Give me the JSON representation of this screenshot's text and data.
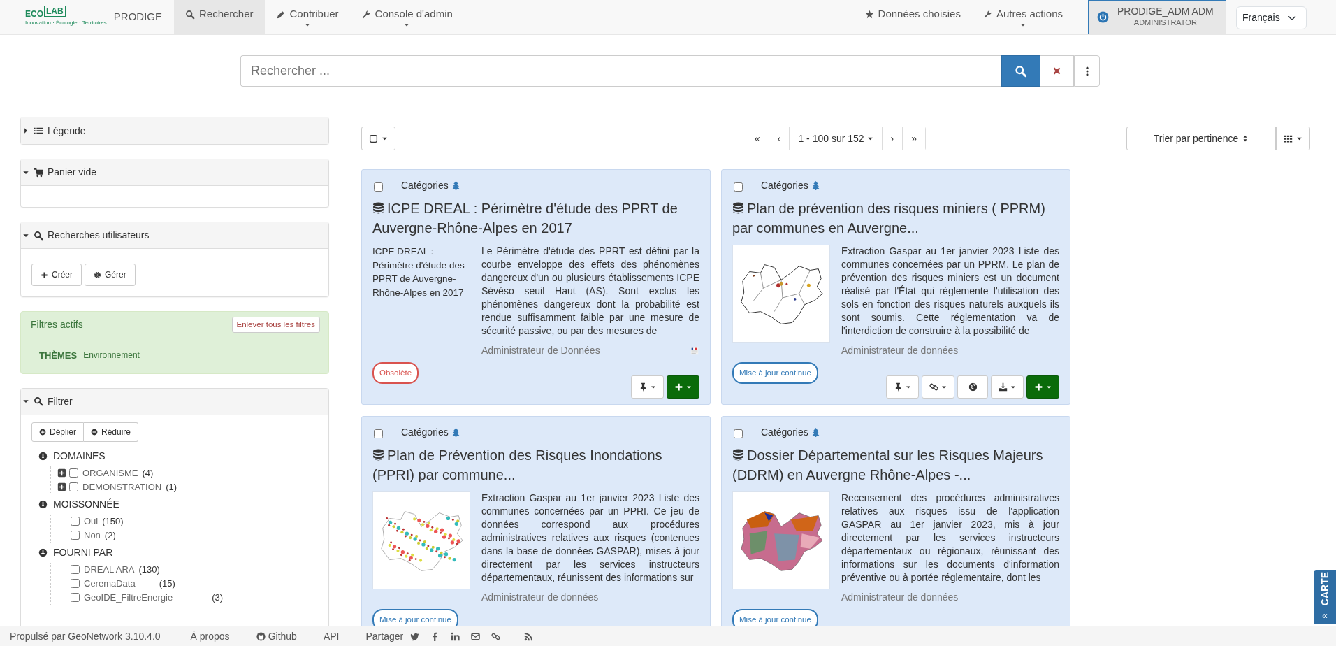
{
  "navbar": {
    "logo_left": "ECO",
    "logo_right": "LAB",
    "logo_tagline": "Innovation · Écologie · Territoires",
    "brand": "PRODIGE",
    "items": [
      {
        "label": "Rechercher",
        "selected": true,
        "dropdown": false
      },
      {
        "label": "Contribuer",
        "selected": false,
        "dropdown": true
      },
      {
        "label": "Console d'admin",
        "selected": false,
        "dropdown": true
      }
    ],
    "right_items": [
      {
        "label": "Données choisies",
        "dropdown": false
      },
      {
        "label": "Autres actions",
        "dropdown": true
      }
    ],
    "user": {
      "name": "PRODIGE_ADM ADM",
      "role": "ADMINISTRATOR"
    },
    "language": "Français"
  },
  "search": {
    "placeholder": "Rechercher ..."
  },
  "sidebar": {
    "legend": {
      "title": "Légende",
      "expanded": false
    },
    "cart": {
      "title": "Panier vide",
      "expanded": true
    },
    "user_searches": {
      "title": "Recherches utilisateurs",
      "expanded": true,
      "buttons": [
        "Créer",
        "Gérer"
      ]
    },
    "active_filters": {
      "title": "Filtres actifs",
      "clear_button": "Enlever tous les filtres",
      "filters": [
        {
          "field": "THÈMES",
          "value": "Environnement"
        }
      ]
    },
    "filter": {
      "title": "Filtrer",
      "expanded": true,
      "buttons": [
        "Déplier",
        "Réduire"
      ],
      "groups": [
        {
          "label": "DOMAINES",
          "expanded": true,
          "items": [
            {
              "label": "ORGANISME",
              "count": "(4)",
              "checked": false,
              "expandable": true
            },
            {
              "label": "DEMONSTRATION",
              "count": "(1)",
              "checked": false,
              "expandable": true
            }
          ]
        },
        {
          "label": "MOISSONNÉE",
          "expanded": true,
          "items": [
            {
              "label": "Oui",
              "count": "(150)",
              "checked": false,
              "expandable": false
            },
            {
              "label": "Non",
              "count": "(2)",
              "checked": false,
              "expandable": false
            }
          ]
        },
        {
          "label": "FOURNI PAR",
          "expanded": true,
          "items": [
            {
              "label": "DREAL ARA",
              "count": "(130)",
              "checked": false,
              "expandable": false
            },
            {
              "label": "CeremaData",
              "count": "(15)",
              "checked": false,
              "expandable": false
            },
            {
              "label": "GeoIDE_FiltreEnergie",
              "count": "(3)",
              "checked": false,
              "expandable": false
            }
          ]
        }
      ]
    }
  },
  "toolbar": {
    "select_all_checked": false,
    "pagination": [
      "«",
      "‹",
      "1 - 100 sur 152",
      "›",
      "»"
    ],
    "sort": "Trier par pertinence"
  },
  "cards": [
    {
      "checked": false,
      "category": "Catégories",
      "title": "ICPE DREAL : Périmètre d'étude des PPRT de Auvergne-Rhône-Alpes en 2017",
      "thumbnail": {
        "kind": "text",
        "text": "ICPE DREAL : Périmètre d'étude des PPRT de Auvergne-Rhône-Alpes en 2017"
      },
      "abstract": "Le Périmètre d'étude des PPRT est défini par la courbe enveloppe des effets des phénomènes dangereux d'un ou plusieurs établissements ICPE Sévéso seuil Haut (AS). Sont exclus les phénomènes dangereux dont la probabilité est rendue suffisamment faible par une mesure de sécurité passive, ou par des mesures de",
      "author": "Administrateur de Données",
      "flag": true,
      "status": {
        "kind": "obsolete",
        "label": "Obsolète"
      },
      "actions": [
        {
          "kind": "pin",
          "dropdown": true
        },
        {
          "kind": "add",
          "dropdown": true
        }
      ]
    },
    {
      "checked": false,
      "category": "Catégories",
      "title": "Plan de prévention des risques miniers ( PPRM) par communes en Auvergne...",
      "thumbnail": {
        "kind": "outline_map"
      },
      "abstract": "Extraction Gaspar au 1er janvier 2023 Liste des communes concernées par un PPRM. Le plan de prévention des risques miniers est un document réalisé par l'État qui réglemente l'utilisation des sols en fonction des risques naturels auxquels ils sont soumis. Cette réglementation va de l'interdiction de construire à la possibilité de",
      "author": "Administrateur de données",
      "flag": false,
      "status": {
        "kind": "continuous",
        "label": "Mise à jour continue"
      },
      "actions": [
        {
          "kind": "pin",
          "dropdown": true
        },
        {
          "kind": "links",
          "dropdown": true
        },
        {
          "kind": "globe",
          "dropdown": false
        },
        {
          "kind": "download",
          "dropdown": true
        },
        {
          "kind": "add",
          "dropdown": true
        }
      ]
    },
    {
      "checked": false,
      "category": "Catégories",
      "title": "Plan de Prévention des Risques Inondations (PPRI) par commune...",
      "thumbnail": {
        "kind": "dotted_map"
      },
      "abstract": "Extraction Gaspar au 1er janvier 2023 Liste des communes concernées par un PPRI. Ce jeu de données correspond aux procédures administratives relatives aux risques (contenues dans la base de données GASPAR), mises à jour directement par les services instructeurs départementaux, réunissent des informations sur",
      "author": "Administrateur de données",
      "flag": false,
      "status": {
        "kind": "continuous",
        "label": "Mise à jour continue"
      }
    },
    {
      "checked": false,
      "category": "Catégories",
      "title": "Dossier Départemental sur les Risques Majeurs (DDRM) en Auvergne Rhône-Alpes -...",
      "thumbnail": {
        "kind": "colored_map"
      },
      "abstract": "Recensement des procédures administratives relatives aux risques issu de l'application GASPAR au 1er janvier 2023, mis à jour directement par les services instructeurs départementaux ou régionaux, réunissant des informations sur les documents d'information préventive ou à portée réglementaire, dont les",
      "author": "Administrateur de données",
      "flag": false,
      "status": {
        "kind": "continuous",
        "label": "Mise à jour continue"
      }
    }
  ],
  "map_tab": {
    "arrows": "«",
    "label": "CARTE"
  },
  "footer": {
    "powered_by": "Propulsé par GeoNetwork 3.10.4.0",
    "links": [
      "À propos",
      "Github",
      "API"
    ],
    "share_label": "Partager"
  }
}
